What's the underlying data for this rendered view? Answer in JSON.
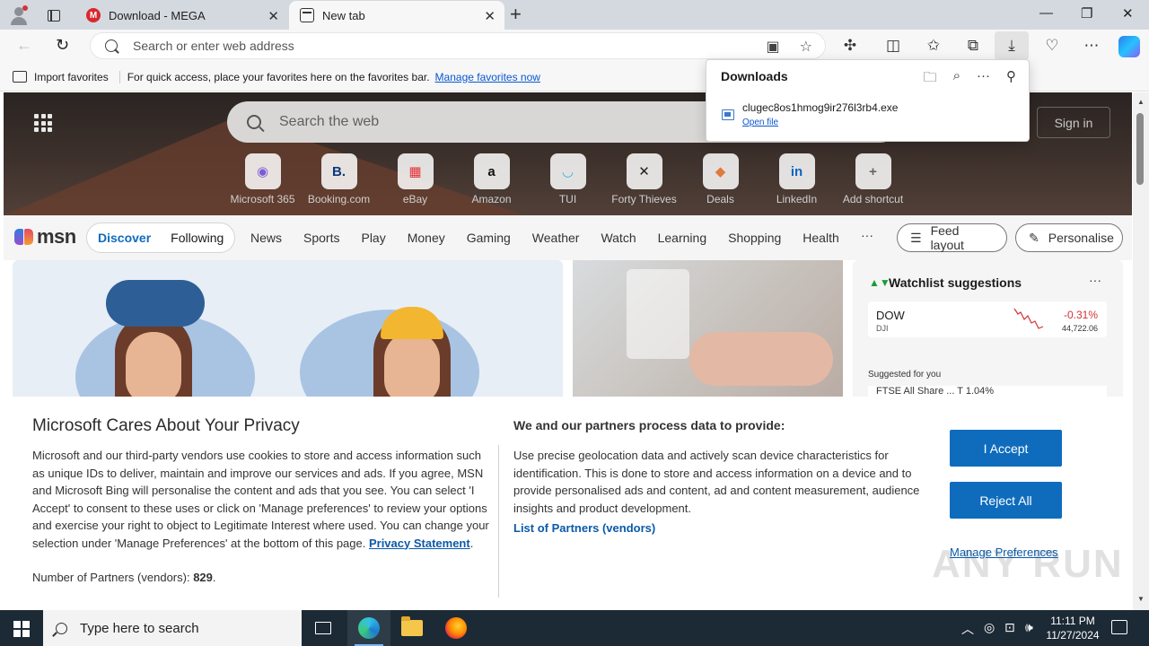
{
  "browser": {
    "tabs": [
      {
        "title": "Download - MEGA",
        "favicon": "mega-icon"
      },
      {
        "title": "New tab",
        "favicon": "newtab-icon"
      }
    ],
    "address_placeholder": "Search or enter web address"
  },
  "favorites_bar": {
    "import_label": "Import favorites",
    "hint": "For quick access, place your favorites here on the favorites bar.",
    "manage_link": "Manage favorites now"
  },
  "downloads": {
    "title": "Downloads",
    "file_name": "clugec8os1hmog9ir276l3rb4.exe",
    "action": "Open file"
  },
  "newtab": {
    "search_placeholder": "Search the web",
    "sign_in": "Sign in",
    "shortcuts": [
      {
        "label": "Microsoft 365",
        "icon": "m365-icon",
        "glyph": "◉",
        "color": "#7a5cd6"
      },
      {
        "label": "Booking.com",
        "icon": "booking-icon",
        "glyph": "B.",
        "color": "#0a3a7a"
      },
      {
        "label": "eBay",
        "icon": "ebay-icon",
        "glyph": "▦",
        "color": "#e53238"
      },
      {
        "label": "Amazon",
        "icon": "amazon-icon",
        "glyph": "a",
        "color": "#111111"
      },
      {
        "label": "TUI",
        "icon": "tui-icon",
        "glyph": "◡",
        "color": "#3db3e3"
      },
      {
        "label": "Forty Thieves",
        "icon": "forty-thieves-icon",
        "glyph": "✕",
        "color": "#222222"
      },
      {
        "label": "Deals",
        "icon": "deals-icon",
        "glyph": "◆",
        "color": "#e07a3c"
      },
      {
        "label": "LinkedIn",
        "icon": "linkedin-icon",
        "glyph": "in",
        "color": "#0a66c2"
      },
      {
        "label": "Add shortcut",
        "icon": "plus-icon",
        "glyph": "+",
        "color": "#666666"
      }
    ]
  },
  "msn": {
    "logo": "msn",
    "pill_tabs": [
      "Discover",
      "Following"
    ],
    "nav": [
      "News",
      "Sports",
      "Play",
      "Money",
      "Gaming",
      "Weather",
      "Watch",
      "Learning",
      "Shopping",
      "Health"
    ],
    "more": "···",
    "feed_layout": "Feed layout",
    "personalise": "Personalise"
  },
  "watchlist": {
    "title": "Watchlist suggestions",
    "stock": {
      "symbol": "DOW",
      "sub": "DJI",
      "change": "-0.31%",
      "price": "44,722.06"
    },
    "suggested": "Suggested for you",
    "next_row": "FTSE All Share ...  T       1.04%"
  },
  "privacy": {
    "title": "Microsoft Cares About Your Privacy",
    "body_before_link": "Microsoft and our third-party vendors use cookies to store and access information such as unique IDs to deliver, maintain and improve our services and ads. If you agree, MSN and Microsoft Bing will personalise the content and ads that you see. You can select 'I Accept' to consent to these uses or click on 'Manage preferences' to review your options and exercise your right to object to Legitimate Interest where used.  You can change your selection under 'Manage Preferences' at the bottom of this page.  ",
    "statement_link": "Privacy Statement",
    "partners_label": "Number of Partners (vendors): ",
    "partners_count": "829",
    "purpose_title": "We and our partners process data to provide:",
    "purpose_body": "Use precise geolocation data and actively scan device characteristics for identification. This is done to store and access information on a device and to provide personalised ads and content, ad and content measurement, audience insights and product development.",
    "partners_link": "List of Partners (vendors)",
    "accept": "I Accept",
    "reject": "Reject All",
    "manage": "Manage Preferences"
  },
  "watermark": "ANY RUN",
  "taskbar": {
    "search_placeholder": "Type here to search",
    "time": "11:11 PM",
    "date": "11/27/2024"
  }
}
